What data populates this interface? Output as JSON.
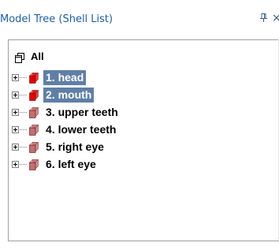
{
  "window": {
    "title": "Model Tree (Shell List)",
    "pin_glyph": "ᶮ",
    "close_glyph": "×"
  },
  "tree": {
    "root": {
      "label": "All",
      "icon": "pages-icon"
    },
    "items": [
      {
        "label": "1. head",
        "selected": true,
        "icon": "shell-icon-red",
        "color": "#e00000"
      },
      {
        "label": "2. mouth",
        "selected": true,
        "icon": "shell-icon-red",
        "color": "#e00000"
      },
      {
        "label": "3. upper teeth",
        "selected": false,
        "icon": "shell-icon-rose",
        "color": "#c07070"
      },
      {
        "label": "4. lower teeth",
        "selected": false,
        "icon": "shell-icon-rose",
        "color": "#c07070"
      },
      {
        "label": "5. right eye",
        "selected": false,
        "icon": "shell-icon-rose",
        "color": "#c07070"
      },
      {
        "label": "6. left eye",
        "selected": false,
        "icon": "shell-icon-rose",
        "color": "#c07070"
      }
    ]
  },
  "colors": {
    "selection_bg": "#5f7fa5",
    "title_text": "#1f5fa0"
  }
}
